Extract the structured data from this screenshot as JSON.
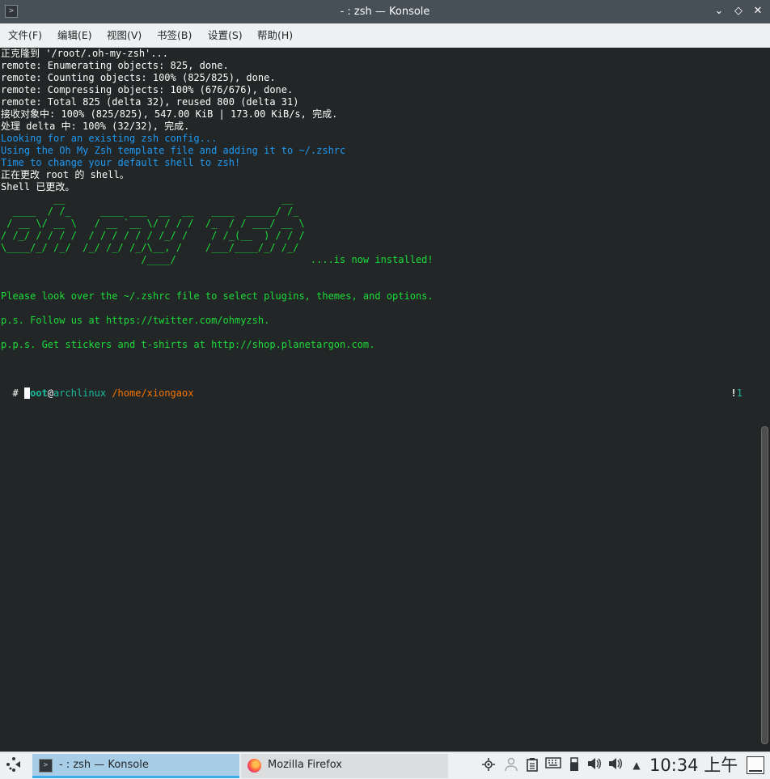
{
  "window": {
    "title": "- : zsh — Konsole",
    "icon": "konsole-icon",
    "controls": [
      "minimize-icon",
      "maximize-icon",
      "close-icon"
    ]
  },
  "menubar": {
    "items": [
      "文件(F)",
      "编辑(E)",
      "视图(V)",
      "书签(B)",
      "设置(S)",
      "帮助(H)"
    ]
  },
  "terminal": {
    "lines": [
      {
        "text": "正克隆到 '/root/.oh-my-zsh'...",
        "color": "white"
      },
      {
        "text": "remote: Enumerating objects: 825, done.",
        "color": "white"
      },
      {
        "text": "remote: Counting objects: 100% (825/825), done.",
        "color": "white"
      },
      {
        "text": "remote: Compressing objects: 100% (676/676), done.",
        "color": "white"
      },
      {
        "text": "remote: Total 825 (delta 32), reused 800 (delta 31)",
        "color": "white"
      },
      {
        "text": "接收对象中: 100% (825/825), 547.00 KiB | 173.00 KiB/s, 完成.",
        "color": "white"
      },
      {
        "text": "处理 delta 中: 100% (32/32), 完成.",
        "color": "white"
      },
      {
        "text": "Looking for an existing zsh config...",
        "color": "blue"
      },
      {
        "text": "Using the Oh My Zsh template file and adding it to ~/.zshrc",
        "color": "blue"
      },
      {
        "text": "Time to change your default shell to zsh!",
        "color": "blue"
      },
      {
        "text": "正在更改 root 的 shell。",
        "color": "white"
      },
      {
        "text": "Shell 已更改。",
        "color": "white"
      }
    ],
    "ascii_art": [
      "         __                                     __   ",
      "  ____  / /_     ____ ___  __  __   ____  _____/ /_  ",
      " / __ \\/ __ \\   / __ `__ \\/ / / /  /_  / / ___/ __ \\ ",
      "/ /_/ / / / /  / / / / / / /_/ /    / /_(__  ) / / / ",
      "\\____/_/ /_/  /_/ /_/ /_/\\__, /    /___/____/_/ /_/  ",
      "                        /____/                       ....is now installed!"
    ],
    "messages": [
      "Please look over the ~/.zshrc file to select plugins, themes, and options.",
      "p.s. Follow us at https://twitter.com/ohmyzsh.",
      "p.p.s. Get stickers and t-shirts at http://shop.planetargon.com."
    ],
    "prompt": {
      "user": "root",
      "at": "@",
      "host": "archlinux",
      "path": "/home/xiongaox",
      "symbol": "#",
      "git_status_mark": "!",
      "git_status_count": "1"
    }
  },
  "taskbar": {
    "launcher_icon": "application-launcher-icon",
    "tasks": [
      {
        "label": "- : zsh — Konsole",
        "icon": "konsole-icon",
        "active": true
      },
      {
        "label": "Mozilla Firefox",
        "icon": "firefox-icon",
        "active": false
      }
    ],
    "tray_icons": [
      "kde-connect-icon",
      "user-icon",
      "clipboard-icon",
      "keyboard-icon",
      "usb-device-icon",
      "volume-icon",
      "audio-icon",
      "expand-tray-icon"
    ],
    "clock": "10:34 上午",
    "show_desktop_icon": "show-desktop-icon"
  },
  "colors": {
    "terminal_bg": "#232627",
    "info_blue": "#1d99f3",
    "success_green": "#1cdc3a",
    "prompt_cyan": "#1abc9c",
    "path_orange": "#f67400",
    "titlebar": "#475057",
    "accent": "#3daee9"
  }
}
